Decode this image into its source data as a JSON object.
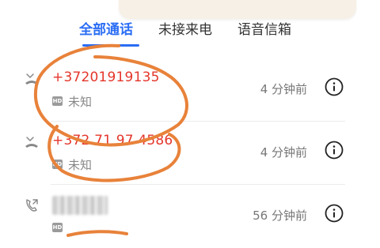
{
  "tabs": [
    {
      "label": "全部通话",
      "active": true
    },
    {
      "label": "未接来电",
      "active": false
    },
    {
      "label": "语音信箱",
      "active": false
    }
  ],
  "calls": [
    {
      "number": "+37201919135",
      "label": "未知",
      "badge": "HD",
      "time": "4 分钟前",
      "type": "missed",
      "icon": "missed-call-icon"
    },
    {
      "number": "+372 71 97 4586",
      "label": "未知",
      "badge": "HD",
      "time": "4 分钟前",
      "type": "missed",
      "icon": "missed-call-icon"
    },
    {
      "number": "",
      "label": "",
      "badge": "HD",
      "time": "56 分钟前",
      "type": "outgoing",
      "icon": "outgoing-call-icon"
    }
  ],
  "info_icon": "info-icon",
  "colors": {
    "accent": "#2a6df4",
    "missed": "#e4362b",
    "annotation": "#e8823a"
  }
}
